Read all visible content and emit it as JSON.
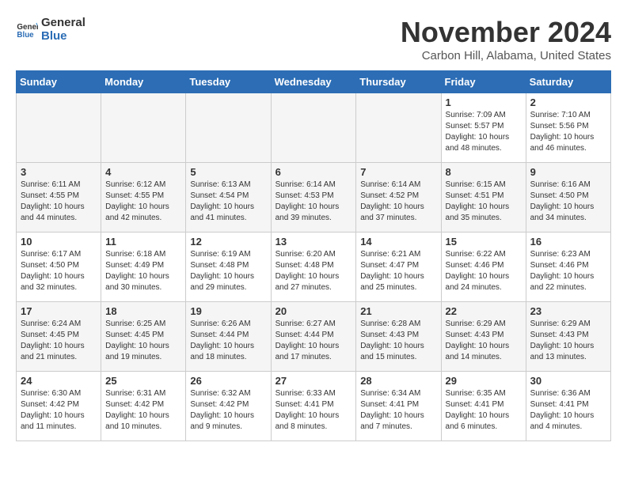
{
  "header": {
    "logo_line1": "General",
    "logo_line2": "Blue",
    "month_title": "November 2024",
    "location": "Carbon Hill, Alabama, United States"
  },
  "weekdays": [
    "Sunday",
    "Monday",
    "Tuesday",
    "Wednesday",
    "Thursday",
    "Friday",
    "Saturday"
  ],
  "weeks": [
    [
      {
        "day": "",
        "info": ""
      },
      {
        "day": "",
        "info": ""
      },
      {
        "day": "",
        "info": ""
      },
      {
        "day": "",
        "info": ""
      },
      {
        "day": "",
        "info": ""
      },
      {
        "day": "1",
        "info": "Sunrise: 7:09 AM\nSunset: 5:57 PM\nDaylight: 10 hours and 48 minutes."
      },
      {
        "day": "2",
        "info": "Sunrise: 7:10 AM\nSunset: 5:56 PM\nDaylight: 10 hours and 46 minutes."
      }
    ],
    [
      {
        "day": "3",
        "info": "Sunrise: 6:11 AM\nSunset: 4:55 PM\nDaylight: 10 hours and 44 minutes."
      },
      {
        "day": "4",
        "info": "Sunrise: 6:12 AM\nSunset: 4:55 PM\nDaylight: 10 hours and 42 minutes."
      },
      {
        "day": "5",
        "info": "Sunrise: 6:13 AM\nSunset: 4:54 PM\nDaylight: 10 hours and 41 minutes."
      },
      {
        "day": "6",
        "info": "Sunrise: 6:14 AM\nSunset: 4:53 PM\nDaylight: 10 hours and 39 minutes."
      },
      {
        "day": "7",
        "info": "Sunrise: 6:14 AM\nSunset: 4:52 PM\nDaylight: 10 hours and 37 minutes."
      },
      {
        "day": "8",
        "info": "Sunrise: 6:15 AM\nSunset: 4:51 PM\nDaylight: 10 hours and 35 minutes."
      },
      {
        "day": "9",
        "info": "Sunrise: 6:16 AM\nSunset: 4:50 PM\nDaylight: 10 hours and 34 minutes."
      }
    ],
    [
      {
        "day": "10",
        "info": "Sunrise: 6:17 AM\nSunset: 4:50 PM\nDaylight: 10 hours and 32 minutes."
      },
      {
        "day": "11",
        "info": "Sunrise: 6:18 AM\nSunset: 4:49 PM\nDaylight: 10 hours and 30 minutes."
      },
      {
        "day": "12",
        "info": "Sunrise: 6:19 AM\nSunset: 4:48 PM\nDaylight: 10 hours and 29 minutes."
      },
      {
        "day": "13",
        "info": "Sunrise: 6:20 AM\nSunset: 4:48 PM\nDaylight: 10 hours and 27 minutes."
      },
      {
        "day": "14",
        "info": "Sunrise: 6:21 AM\nSunset: 4:47 PM\nDaylight: 10 hours and 25 minutes."
      },
      {
        "day": "15",
        "info": "Sunrise: 6:22 AM\nSunset: 4:46 PM\nDaylight: 10 hours and 24 minutes."
      },
      {
        "day": "16",
        "info": "Sunrise: 6:23 AM\nSunset: 4:46 PM\nDaylight: 10 hours and 22 minutes."
      }
    ],
    [
      {
        "day": "17",
        "info": "Sunrise: 6:24 AM\nSunset: 4:45 PM\nDaylight: 10 hours and 21 minutes."
      },
      {
        "day": "18",
        "info": "Sunrise: 6:25 AM\nSunset: 4:45 PM\nDaylight: 10 hours and 19 minutes."
      },
      {
        "day": "19",
        "info": "Sunrise: 6:26 AM\nSunset: 4:44 PM\nDaylight: 10 hours and 18 minutes."
      },
      {
        "day": "20",
        "info": "Sunrise: 6:27 AM\nSunset: 4:44 PM\nDaylight: 10 hours and 17 minutes."
      },
      {
        "day": "21",
        "info": "Sunrise: 6:28 AM\nSunset: 4:43 PM\nDaylight: 10 hours and 15 minutes."
      },
      {
        "day": "22",
        "info": "Sunrise: 6:29 AM\nSunset: 4:43 PM\nDaylight: 10 hours and 14 minutes."
      },
      {
        "day": "23",
        "info": "Sunrise: 6:29 AM\nSunset: 4:43 PM\nDaylight: 10 hours and 13 minutes."
      }
    ],
    [
      {
        "day": "24",
        "info": "Sunrise: 6:30 AM\nSunset: 4:42 PM\nDaylight: 10 hours and 11 minutes."
      },
      {
        "day": "25",
        "info": "Sunrise: 6:31 AM\nSunset: 4:42 PM\nDaylight: 10 hours and 10 minutes."
      },
      {
        "day": "26",
        "info": "Sunrise: 6:32 AM\nSunset: 4:42 PM\nDaylight: 10 hours and 9 minutes."
      },
      {
        "day": "27",
        "info": "Sunrise: 6:33 AM\nSunset: 4:41 PM\nDaylight: 10 hours and 8 minutes."
      },
      {
        "day": "28",
        "info": "Sunrise: 6:34 AM\nSunset: 4:41 PM\nDaylight: 10 hours and 7 minutes."
      },
      {
        "day": "29",
        "info": "Sunrise: 6:35 AM\nSunset: 4:41 PM\nDaylight: 10 hours and 6 minutes."
      },
      {
        "day": "30",
        "info": "Sunrise: 6:36 AM\nSunset: 4:41 PM\nDaylight: 10 hours and 4 minutes."
      }
    ]
  ]
}
